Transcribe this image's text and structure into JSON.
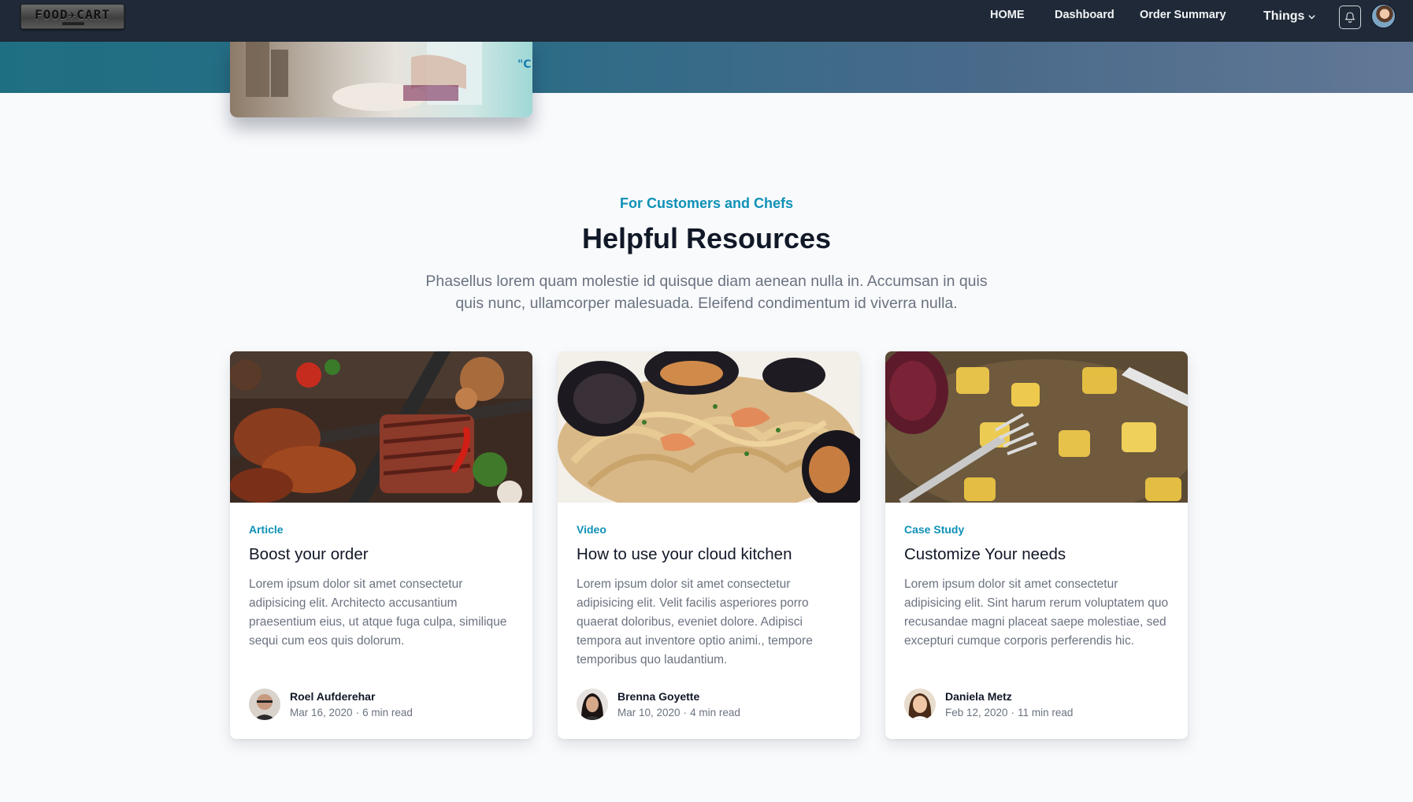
{
  "brand": {
    "logo_text": "FOOD✈CART"
  },
  "nav": {
    "links": [
      "HOME",
      "Dashboard",
      "Order Summary"
    ],
    "dropdown_label": "Things"
  },
  "section": {
    "eyebrow": "For Customers and Chefs",
    "title": "Helpful Resources",
    "description": "Phasellus lorem quam molestie id quisque diam aenean nulla in. Accumsan in quis quis nunc, ullamcorper malesuada. Eleifend condimentum id viverra nulla."
  },
  "cards": [
    {
      "category": "Article",
      "title": "Boost your order",
      "body": "Lorem ipsum dolor sit amet consectetur adipisicing elit. Architecto accusantium praesentium eius, ut atque fuga culpa, similique sequi cum eos quis dolorum.",
      "author": "Roel Aufderehar",
      "date": "Mar 16, 2020",
      "read_time": "6 min read"
    },
    {
      "category": "Video",
      "title": "How to use your cloud kitchen",
      "body": "Lorem ipsum dolor sit amet consectetur adipisicing elit. Velit facilis asperiores porro quaerat doloribus, eveniet dolore. Adipisci tempora aut inventore optio animi., tempore temporibus quo laudantium.",
      "author": "Brenna Goyette",
      "date": "Mar 10, 2020",
      "read_time": "4 min read"
    },
    {
      "category": "Case Study",
      "title": "Customize Your needs",
      "body": "Lorem ipsum dolor sit amet consectetur adipisicing elit. Sint harum rerum voluptatem quo recusandae magni placeat saepe molestiae, sed excepturi cumque corporis perferendis hic.",
      "author": "Daniela Metz",
      "date": "Feb 12, 2020",
      "read_time": "11 min read"
    }
  ],
  "meta_separator": "·",
  "icons": [
    "bell-icon",
    "chevron-down-icon",
    "user-avatar",
    "logo"
  ],
  "colors": {
    "nav_bg": "#1f2937",
    "accent": "#0e91b6",
    "page_bg": "#f8fafc"
  }
}
